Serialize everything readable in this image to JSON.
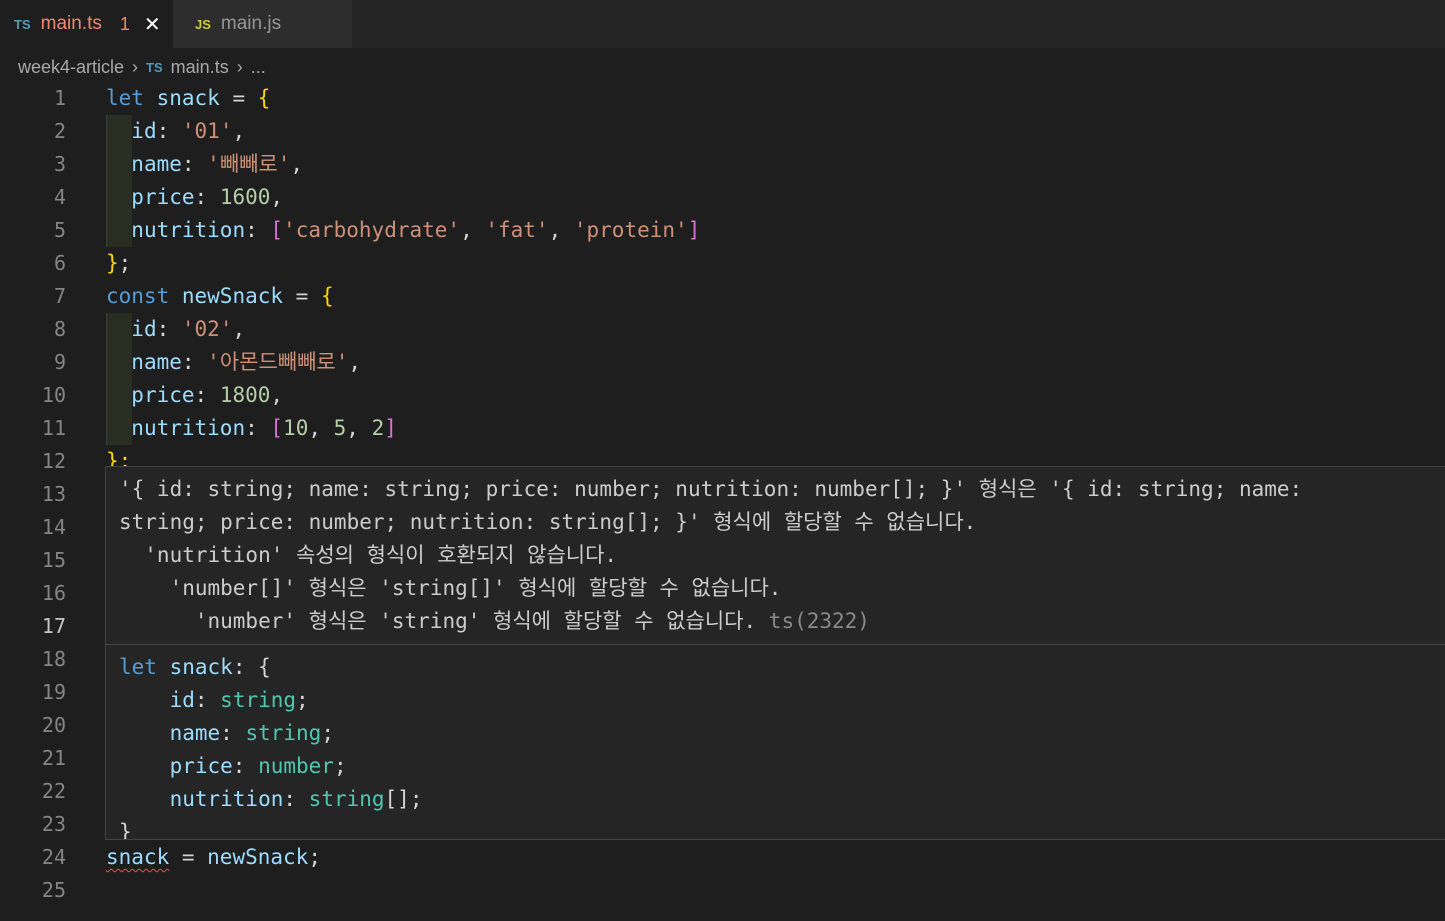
{
  "tabs": [
    {
      "icon": "TS",
      "name": "main.ts",
      "errors": "1",
      "close": "✕"
    },
    {
      "icon": "JS",
      "name": "main.js"
    }
  ],
  "breadcrumb": {
    "folder": "week4-article",
    "sep": "›",
    "icon": "TS",
    "file": "main.ts",
    "rest": "..."
  },
  "line_numbers": [
    "1",
    "2",
    "3",
    "4",
    "5",
    "6",
    "7",
    "8",
    "9",
    "10",
    "11",
    "12",
    "13",
    "14",
    "15",
    "16",
    "17",
    "18",
    "19",
    "20",
    "21",
    "22",
    "23",
    "24",
    "25"
  ],
  "code": {
    "l1": {
      "kw": "let",
      "var": "snack",
      "eq": " = ",
      "brace": "{"
    },
    "l2": {
      "prop": "id",
      "colon": ": ",
      "str": "'01'",
      "comma": ","
    },
    "l3": {
      "prop": "name",
      "colon": ": ",
      "str": "'빼빼로'",
      "comma": ","
    },
    "l4": {
      "prop": "price",
      "colon": ": ",
      "num": "1600",
      "comma": ","
    },
    "l5": {
      "prop": "nutrition",
      "colon": ": ",
      "open": "[",
      "s1": "'carbohydrate'",
      "c1": ", ",
      "s2": "'fat'",
      "c2": ", ",
      "s3": "'protein'",
      "close": "]"
    },
    "l6": {
      "brace": "}",
      "semi": ";"
    },
    "l7": {
      "kw": "const",
      "var": "newSnack",
      "eq": " = ",
      "brace": "{"
    },
    "l8": {
      "prop": "id",
      "colon": ": ",
      "str": "'02'",
      "comma": ","
    },
    "l9": {
      "prop": "name",
      "colon": ": ",
      "str": "'아몬드빼빼로'",
      "comma": ","
    },
    "l10": {
      "prop": "price",
      "colon": ": ",
      "num": "1800",
      "comma": ","
    },
    "l11": {
      "prop": "nutrition",
      "colon": ": ",
      "open": "[",
      "n1": "10",
      "c1": ", ",
      "n2": "5",
      "c2": ", ",
      "n3": "2",
      "close": "]"
    },
    "l12": {
      "text": "};"
    },
    "l24": {
      "var": "snack",
      "eq": " = ",
      "var2": "newSnack",
      "semi": ";"
    }
  },
  "hover": {
    "msg1": "'{ id: string; name: string; price: number; nutrition: number[]; }' 형식은 '{ id: string; name:",
    "msg2": "string; price: number; nutrition: string[]; }' 형식에 할당할 수 없습니다.",
    "msg3": "  'nutrition' 속성의 형식이 호환되지 않습니다.",
    "msg4": "    'number[]' 형식은 'string[]' 형식에 할당할 수 없습니다.",
    "msg5": "      'number' 형식은 'string' 형식에 할당할 수 없습니다.",
    "code": "ts(2322)",
    "sig": {
      "kw": "let",
      "var": "snack",
      "colon": ": ",
      "open": "{",
      "fields": [
        {
          "name": "id",
          "type": "string",
          "suffix": ";"
        },
        {
          "name": "name",
          "type": "string",
          "suffix": ";"
        },
        {
          "name": "price",
          "type": "number",
          "suffix": ";"
        },
        {
          "name": "nutrition",
          "type": "string",
          "suffix": "[];"
        }
      ],
      "close": "}"
    }
  },
  "colors": {
    "error": "#f48771",
    "keyword": "#569cd6",
    "string": "#ce9178",
    "number": "#b5cea8",
    "type": "#4ec9b0",
    "brace": "#ffd700",
    "bracket": "#da70d6"
  }
}
